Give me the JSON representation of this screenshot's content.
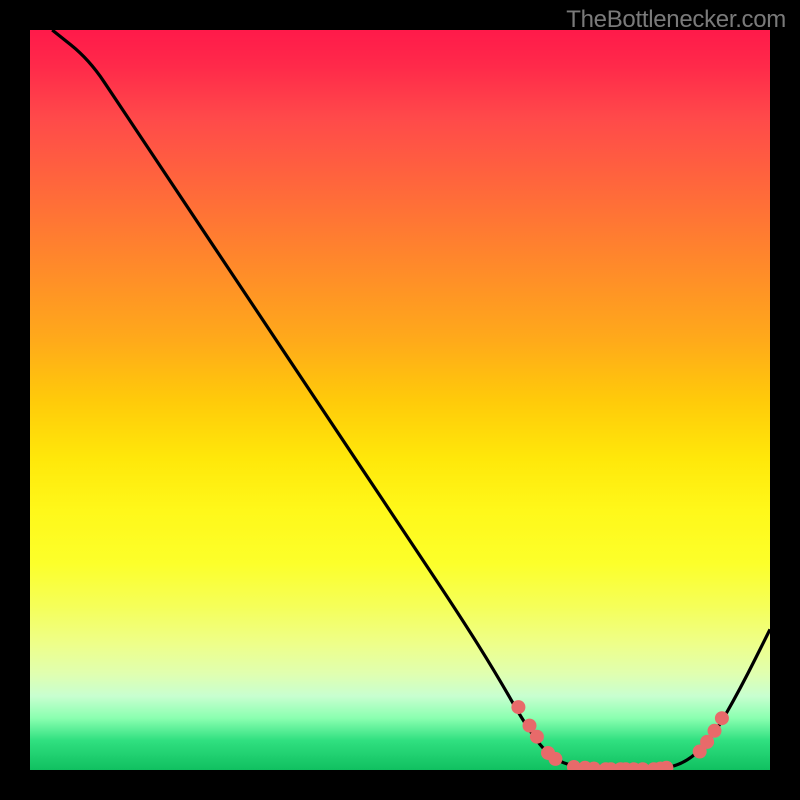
{
  "attribution": "TheBottlenecker.com",
  "chart_data": {
    "type": "line",
    "title": "",
    "xlabel": "",
    "ylabel": "",
    "ylim": [
      0,
      100
    ],
    "xlim": [
      0,
      100
    ],
    "curve": [
      {
        "x": 3,
        "y": 100
      },
      {
        "x": 8,
        "y": 96
      },
      {
        "x": 12,
        "y": 90
      },
      {
        "x": 20,
        "y": 78
      },
      {
        "x": 30,
        "y": 63
      },
      {
        "x": 40,
        "y": 48
      },
      {
        "x": 50,
        "y": 33
      },
      {
        "x": 58,
        "y": 21
      },
      {
        "x": 63,
        "y": 13
      },
      {
        "x": 67,
        "y": 6
      },
      {
        "x": 70,
        "y": 2
      },
      {
        "x": 73,
        "y": 0.5
      },
      {
        "x": 78,
        "y": 0
      },
      {
        "x": 83,
        "y": 0
      },
      {
        "x": 88,
        "y": 0.5
      },
      {
        "x": 92,
        "y": 4
      },
      {
        "x": 96,
        "y": 11
      },
      {
        "x": 100,
        "y": 19
      }
    ],
    "dots_left_cluster": [
      {
        "x": 66,
        "y": 8.5
      },
      {
        "x": 67.5,
        "y": 6
      },
      {
        "x": 68.5,
        "y": 4.5
      },
      {
        "x": 70,
        "y": 2.3
      },
      {
        "x": 71,
        "y": 1.5
      }
    ],
    "dots_bottom_cluster": [
      {
        "x": 73.5,
        "y": 0.4
      },
      {
        "x": 75,
        "y": 0.3
      },
      {
        "x": 76.2,
        "y": 0.2
      },
      {
        "x": 77.8,
        "y": 0.1
      },
      {
        "x": 78.5,
        "y": 0.1
      },
      {
        "x": 79.8,
        "y": 0.1
      },
      {
        "x": 80.5,
        "y": 0.1
      },
      {
        "x": 81.6,
        "y": 0.1
      },
      {
        "x": 82.8,
        "y": 0.1
      },
      {
        "x": 84.3,
        "y": 0.1
      },
      {
        "x": 85.2,
        "y": 0.2
      },
      {
        "x": 86.0,
        "y": 0.3
      }
    ],
    "dots_right_cluster": [
      {
        "x": 90.5,
        "y": 2.5
      },
      {
        "x": 91.5,
        "y": 3.8
      },
      {
        "x": 92.5,
        "y": 5.3
      },
      {
        "x": 93.5,
        "y": 7
      }
    ],
    "dot_color": "#e86a6a",
    "dot_radius": 7,
    "curve_stroke": "#000",
    "curve_width": 3.2
  }
}
